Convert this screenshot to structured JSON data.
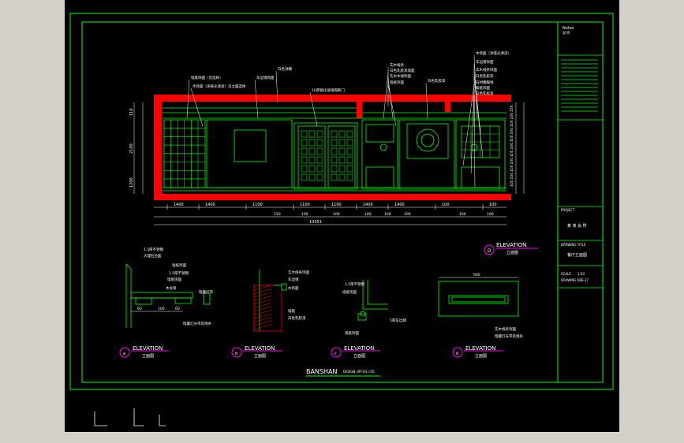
{
  "colors": {
    "background": "#000000",
    "frame": "#00ff00",
    "wall": "#ff0000",
    "text": "#ffffff",
    "accent": "#ff00ff",
    "window_bg": "#d4d0c8"
  },
  "title_block": {
    "notes_label": "Notes",
    "notes_sub": "說 明",
    "project_label": "PROJECT",
    "project_value": "某 某 会 所",
    "drawing_title_label": "DRAWING TITLE",
    "drawing_title_value": "餐厅立面图",
    "scale_label": "SCALE",
    "scale_value": "1:50",
    "drawing_no_label": "DRAWING NO.",
    "drawing_no_value": "E-17"
  },
  "main_elevation": {
    "marker": "D",
    "title": "ELEVATION",
    "subtitle": "立面图",
    "dims_bottom": [
      "1400",
      "1400",
      "1100",
      "1100",
      "1100",
      "1400",
      "1400",
      "100",
      "100"
    ],
    "dims_bottom2": [
      "150",
      "100",
      "100",
      "100",
      "100",
      "100",
      "100",
      "100"
    ],
    "total_dim": "10051",
    "dims_left": [
      "110",
      "2100",
      "1200"
    ],
    "dims_right": [
      "150",
      "100",
      "100",
      "100",
      "100",
      "100",
      "100",
      "100",
      "100",
      "100",
      "100"
    ],
    "callouts": [
      "墙纸饰面（见选样）",
      "木饰面（涂哑光清漆）见立面选样",
      "白色顶棚",
      "车边镜饰面",
      "10厚钢化玻璃隔断门",
      "实木线条",
      "白色乳胶漆墙面",
      "实木木线饰面",
      "墙纸饰面",
      "白色乳胶漆",
      "木饰面（涂哑光清漆）",
      "车边镜饰面",
      "实木线条饰面",
      "白色乳胶漆",
      "石材踢脚线",
      "墙纸饰面",
      "白色乳胶漆"
    ]
  },
  "details": [
    {
      "marker": "a",
      "title": "ELEVATION",
      "subtitle": "立面图",
      "labels": [
        "1.5厚不锈钢",
        "大理石台面",
        "墙纸饰面",
        "1.5厚不锈钢",
        "墙纸饰面",
        "木龙骨",
        "暗藏灯带",
        "暗藏灯光带及线条"
      ],
      "dims": [
        "60",
        "100",
        "60"
      ]
    },
    {
      "marker": "b",
      "title": "ELEVATION",
      "subtitle": "立面图",
      "labels": [
        "实木线条饰面",
        "车边镜",
        "木饰面",
        "墙纸",
        "白色乳胶漆"
      ]
    },
    {
      "marker": "c",
      "title": "ELEVATION",
      "subtitle": "立面图",
      "labels": [
        "1.5厚不锈钢",
        "墙纸饰面",
        "5厚车边镜",
        "墙纸饰面"
      ]
    },
    {
      "marker": "d",
      "title": "ELEVATION",
      "subtitle": "立面图",
      "labels": [
        "实木线条饰面",
        "暗藏灯光带及线条"
      ],
      "dims": [
        "900"
      ]
    }
  ],
  "company": {
    "name": "BANSHAN",
    "subtitle": "DESIGN OFFICE LTD"
  }
}
